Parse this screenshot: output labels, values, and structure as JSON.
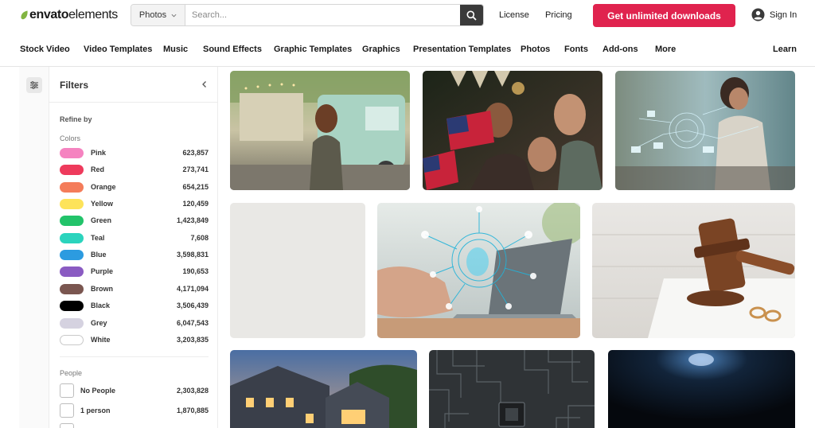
{
  "header": {
    "logo_brand": "envato",
    "logo_sub": "elements",
    "search_category": "Photos",
    "search_placeholder": "Search...",
    "license_label": "License",
    "pricing_label": "Pricing",
    "cta_label": "Get unlimited downloads",
    "signin_label": "Sign In"
  },
  "nav": {
    "items": [
      "Stock Video",
      "Video Templates",
      "Music",
      "Sound Effects",
      "Graphic Templates",
      "Graphics",
      "Presentation Templates",
      "Photos",
      "Fonts",
      "Add-ons",
      "More"
    ],
    "learn": "Learn"
  },
  "filters": {
    "title": "Filters",
    "refine_by": "Refine by",
    "colors_label": "Colors",
    "colors": [
      {
        "name": "Pink",
        "count": "623,857",
        "hex": "#f583c0"
      },
      {
        "name": "Red",
        "count": "273,741",
        "hex": "#ee3a5c"
      },
      {
        "name": "Orange",
        "count": "654,215",
        "hex": "#f47c5a"
      },
      {
        "name": "Yellow",
        "count": "120,459",
        "hex": "#fde35a"
      },
      {
        "name": "Green",
        "count": "1,423,849",
        "hex": "#22c36a"
      },
      {
        "name": "Teal",
        "count": "7,608",
        "hex": "#2bd4bd"
      },
      {
        "name": "Blue",
        "count": "3,598,831",
        "hex": "#2c9be0"
      },
      {
        "name": "Purple",
        "count": "190,653",
        "hex": "#8a5bc2"
      },
      {
        "name": "Brown",
        "count": "4,171,094",
        "hex": "#7a5650"
      },
      {
        "name": "Black",
        "count": "3,506,439",
        "hex": "#000000"
      },
      {
        "name": "Grey",
        "count": "6,047,543",
        "hex": "#d5d2e0"
      },
      {
        "name": "White",
        "count": "3,203,835",
        "hex": "#ffffff"
      }
    ],
    "people_label": "People",
    "people": [
      {
        "label": "No People",
        "count": "2,303,828"
      },
      {
        "label": "1 person",
        "count": "1,870,885"
      }
    ]
  },
  "colors": {
    "accent": "#e0234e",
    "logo_green": "#82b541"
  }
}
